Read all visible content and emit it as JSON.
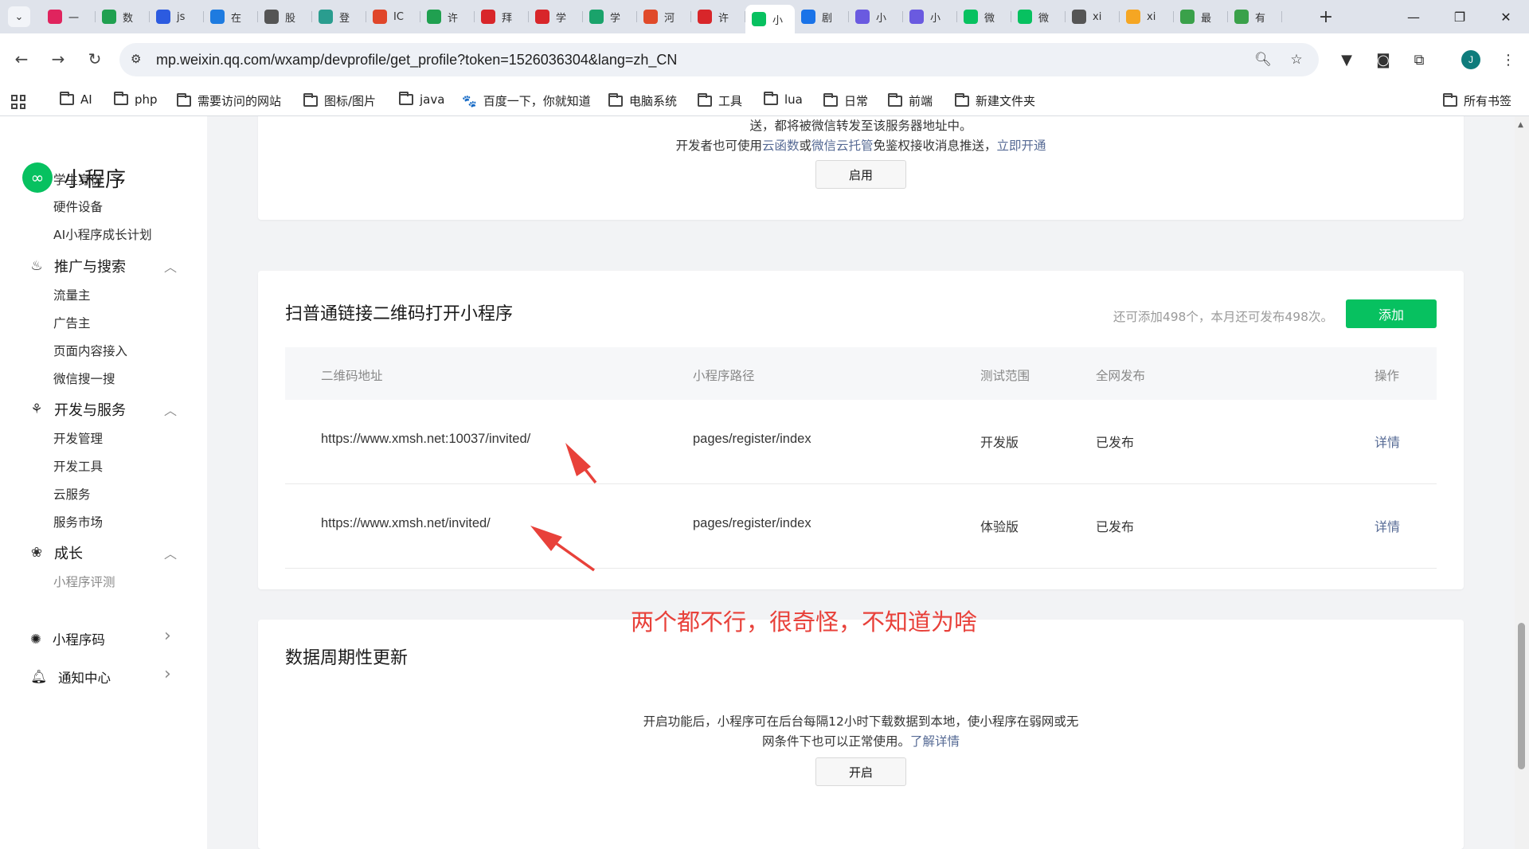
{
  "browser": {
    "tabs": [
      {
        "icon": "tiktok-icon",
        "label": "一",
        "color": "#e0245e"
      },
      {
        "icon": "leaf-icon",
        "label": "数",
        "color": "#20a050"
      },
      {
        "icon": "paw-icon",
        "label": "js",
        "color": "#2c5be0"
      },
      {
        "icon": "b-logo-icon",
        "label": "在",
        "color": "#1e7be0"
      },
      {
        "icon": "globe-icon",
        "label": "股",
        "color": "#555555"
      },
      {
        "icon": "network-icon",
        "label": "登",
        "color": "#2a9d8f"
      },
      {
        "icon": "spiral-icon",
        "label": "IC",
        "color": "#e0462a"
      },
      {
        "icon": "leaf-icon",
        "label": "许",
        "color": "#20a050"
      },
      {
        "icon": "grid-icon",
        "label": "拜",
        "color": "#d8262a"
      },
      {
        "icon": "feather-icon",
        "label": "学",
        "color": "#d8262a"
      },
      {
        "icon": "mountain-icon",
        "label": "学",
        "color": "#1aa36b"
      },
      {
        "icon": "a-logo-icon",
        "label": "河",
        "color": "#e04a2a"
      },
      {
        "icon": "pulse-icon",
        "label": "许",
        "color": "#d8262a"
      },
      {
        "icon": "mini-program-icon",
        "label": "小",
        "color": "#07c160",
        "active": true
      },
      {
        "icon": "chrome-icon",
        "label": "剧",
        "color": "#1a73e8"
      },
      {
        "icon": "mini-program-icon",
        "label": "小",
        "color": "#6a5ae0"
      },
      {
        "icon": "mini-program-icon",
        "label": "小",
        "color": "#6a5ae0"
      },
      {
        "icon": "wechat-icon",
        "label": "微",
        "color": "#07c160"
      },
      {
        "icon": "wechat-icon",
        "label": "微",
        "color": "#07c160"
      },
      {
        "icon": "globe-icon",
        "label": "xi",
        "color": "#555555"
      },
      {
        "icon": "swirl-icon",
        "label": "xi",
        "color": "#f5a623"
      },
      {
        "icon": "tiles-icon",
        "label": "最",
        "color": "#3aa14a"
      },
      {
        "icon": "tiles-icon",
        "label": "有",
        "color": "#3aa14a"
      }
    ],
    "url": "mp.weixin.qq.com/wxamp/devprofile/get_profile?token=1526036304&lang=zh_CN",
    "bookmarks": [
      "AI",
      "php",
      "需要访问的网站",
      "图标/图片",
      "java",
      "百度一下，你就知道",
      "电脑系统",
      "工具",
      "lua",
      "日常",
      "前端",
      "新建文件夹"
    ],
    "all_bookmarks": "所有书签",
    "profile_initial": "J"
  },
  "sidebar": {
    "logo_text": "小程序",
    "top_items": [
      "学生身份",
      "硬件设备",
      "AI小程序成长计划"
    ],
    "groups": [
      {
        "label": "推广与搜索",
        "icon": "flame-icon",
        "items": [
          "流量主",
          "广告主",
          "页面内容接入",
          "微信搜一搜"
        ]
      },
      {
        "label": "开发与服务",
        "icon": "apps-cluster-icon",
        "items": [
          "开发管理",
          "开发工具",
          "云服务",
          "服务市场"
        ]
      },
      {
        "label": "成长",
        "icon": "lotus-icon",
        "items": [
          "小程序评测"
        ]
      }
    ],
    "bottom_items": [
      {
        "label": "小程序码",
        "icon": "qrcode-sun-icon"
      },
      {
        "label": "通知中心",
        "icon": "bell-icon"
      }
    ]
  },
  "push_card": {
    "line1": "送，都将被微信转发至该服务器地址中。",
    "line2_prefix": "开发者也可使用",
    "link_cloud_function": "云函数",
    "or": "或",
    "link_cloud_hosting": "微信云托管",
    "line2_suffix": "免鉴权接收消息推送，",
    "link_enable_now": "立即开通",
    "button": "启用"
  },
  "qrcode_card": {
    "title": "扫普通链接二维码打开小程序",
    "quota": "还可添加498个，本月还可发布498次。",
    "add_button": "添加",
    "columns": [
      "二维码地址",
      "小程序路径",
      "测试范围",
      "全网发布",
      "操作"
    ],
    "rows": [
      {
        "url": "https://www.xmsh.net:10037/invited/",
        "path": "pages/register/index",
        "scope": "开发版",
        "status": "已发布",
        "action": "详情"
      },
      {
        "url": "https://www.xmsh.net/invited/",
        "path": "pages/register/index",
        "scope": "体验版",
        "status": "已发布",
        "action": "详情"
      }
    ]
  },
  "annotation": "两个都不行，很奇怪，不知道为啥",
  "data_card": {
    "title": "数据周期性更新",
    "line1": "开启功能后，小程序可在后台每隔12小时下载数据到本地，使小程序在弱网或无",
    "line2": "网条件下也可以正常使用。",
    "link_more": "了解详情",
    "button": "开启"
  },
  "colors": {
    "brand_green": "#07c160",
    "link_blue": "#576b95",
    "annotation_red": "#e8413a"
  }
}
